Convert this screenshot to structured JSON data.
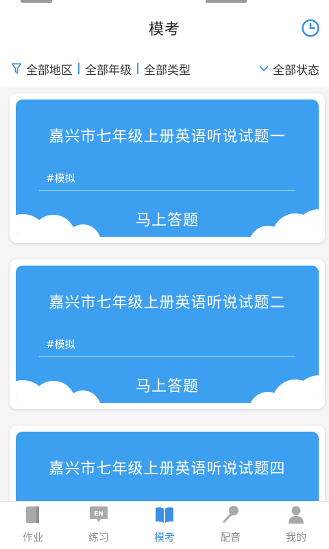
{
  "header": {
    "title": "模考",
    "history_icon": "clock-icon"
  },
  "filters": {
    "region": "全部地区",
    "grade": "全部年级",
    "type": "全部类型",
    "status": "全部状态",
    "filter_icon": "funnel-icon",
    "status_icon": "chevron-down-icon"
  },
  "cards": [
    {
      "title": "嘉兴市七年级上册英语听说试题一",
      "tag": "#模拟",
      "action": "马上答题"
    },
    {
      "title": "嘉兴市七年级上册英语听说试题二",
      "tag": "#模拟",
      "action": "马上答题"
    },
    {
      "title": "嘉兴市七年级上册英语听说试题四"
    }
  ],
  "tabs": [
    {
      "label": "作业",
      "icon": "notebook-icon"
    },
    {
      "label": "练习",
      "icon": "en-bubble-icon"
    },
    {
      "label": "模考",
      "icon": "open-book-icon",
      "active": true
    },
    {
      "label": "配音",
      "icon": "microphone-icon"
    },
    {
      "label": "我的",
      "icon": "person-icon"
    }
  ],
  "colors": {
    "accent": "#3a8ee6",
    "card": "#3d9ff0",
    "tab_inactive": "#8a8a8a"
  }
}
